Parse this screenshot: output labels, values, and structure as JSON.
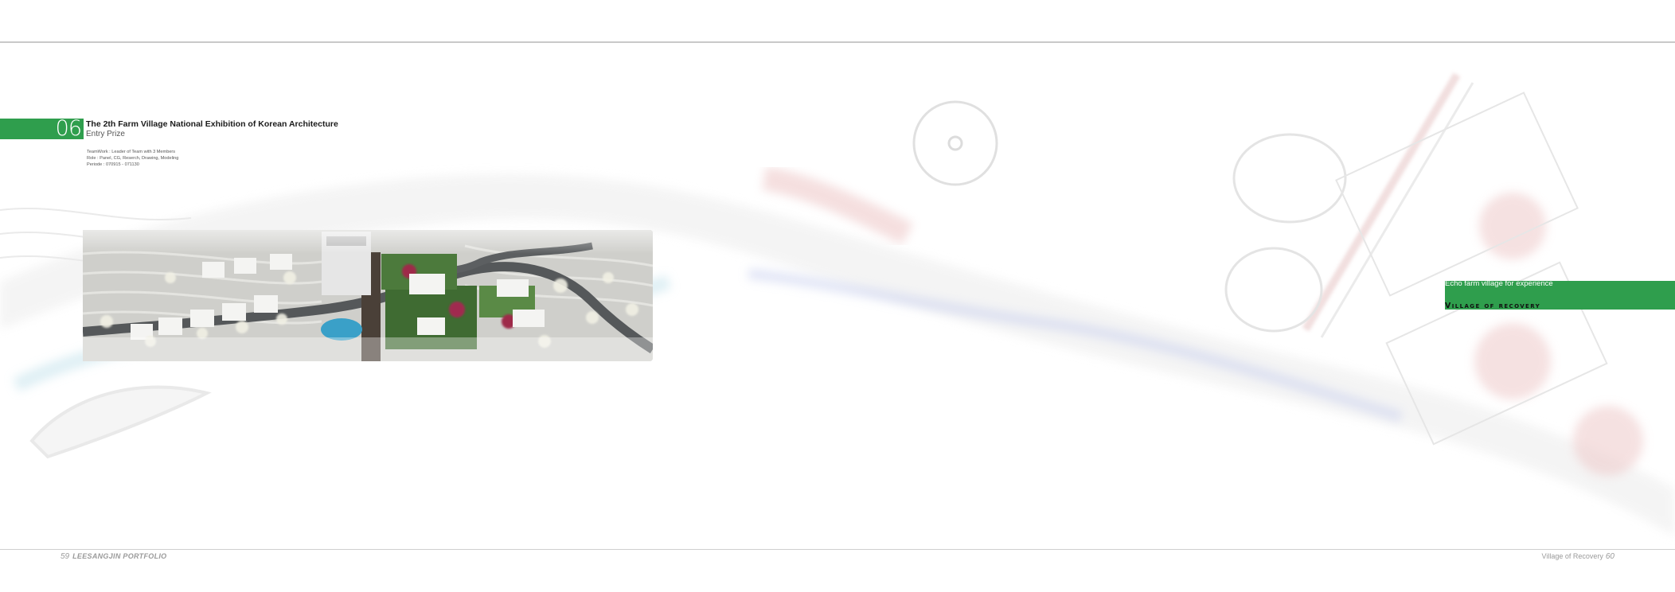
{
  "project": {
    "number": "06",
    "title": "The 2th Farm Village National Exhibition of Korean Architecture",
    "subtitle": "Entry Prize",
    "details": [
      "TeamWork : Leader of Team with 3 Members",
      "Role : Panel, CG, Reserch, Drawing, Modeling",
      "Periode : 070915 - 071130"
    ]
  },
  "right_panel": {
    "tagline": "Echo farm village for experience",
    "heading": "Village of recovery"
  },
  "footer": {
    "left_page": "59",
    "left_label": "LEESANGJIN PORTFOLIO",
    "right_label": "Village of Recovery",
    "right_page": "60"
  },
  "colors": {
    "accent": "#2f9e4d",
    "rule": "#c9c9c9",
    "footer_text": "#9a9a9a"
  }
}
